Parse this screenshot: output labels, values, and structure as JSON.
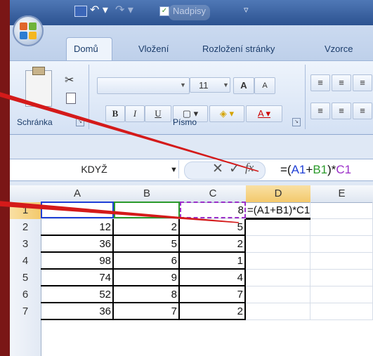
{
  "quick_access": {
    "title": "Nadpisy"
  },
  "ribbon": {
    "tabs": [
      "Domů",
      "Vložení",
      "Rozložení stránky",
      "Vzorce"
    ],
    "active_tab": "Domů",
    "font_size": "11",
    "groups": {
      "clipboard": "Schránka",
      "font": "Písmo"
    },
    "buttons": {
      "bold": "B",
      "italic": "I",
      "underline": "U",
      "grow_font": "A",
      "shrink_font": "A"
    }
  },
  "formula_bar": {
    "name_box": "KDYŽ",
    "formula": "=(A1+B1)*C1",
    "fx": "fx"
  },
  "columns": [
    "A",
    "B",
    "C",
    "D",
    "E"
  ],
  "rows": [
    {
      "num": "1",
      "A": "",
      "B": "",
      "C": "8",
      "D": "=(A1+B1)*C1"
    },
    {
      "num": "2",
      "A": "12",
      "B": "2",
      "C": "5",
      "D": ""
    },
    {
      "num": "3",
      "A": "36",
      "B": "5",
      "C": "2",
      "D": ""
    },
    {
      "num": "4",
      "A": "98",
      "B": "6",
      "C": "1",
      "D": ""
    },
    {
      "num": "5",
      "A": "74",
      "B": "9",
      "C": "4",
      "D": ""
    },
    {
      "num": "6",
      "A": "52",
      "B": "8",
      "C": "7",
      "D": ""
    },
    {
      "num": "7",
      "A": "36",
      "B": "7",
      "C": "2",
      "D": ""
    }
  ],
  "colors": {
    "frame": "#7a1616",
    "arrow": "#d41a1a",
    "ref_a": "#1f3fd6",
    "ref_b": "#2a9a2a",
    "ref_c": "#9b2fc8"
  }
}
